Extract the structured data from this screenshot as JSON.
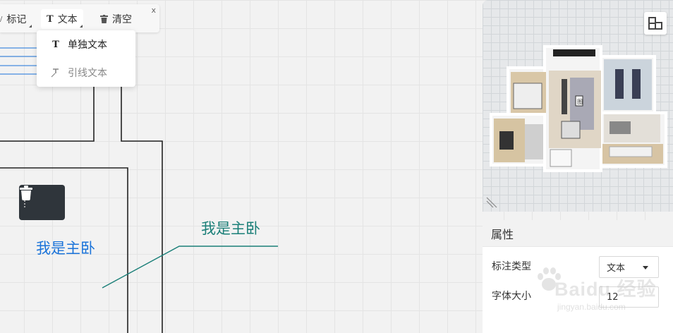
{
  "toolbar": {
    "mark_label": "标记",
    "text_label": "文本",
    "clear_label": "清空",
    "close_label": "x",
    "text_icon": "T"
  },
  "dropdown": {
    "items": [
      {
        "label": "单独文本",
        "icon": "T",
        "state": "active"
      },
      {
        "label": "引线文本",
        "icon": "leader-text-icon",
        "state": "inactive"
      }
    ]
  },
  "canvas": {
    "label_blue": "我是主卧",
    "label_teal": "我是主卧",
    "label_blue_color": "#1a73d9",
    "label_teal_color": "#1a7f78"
  },
  "preview": {
    "icon": "floorplan-toggle-icon",
    "room_label": "图"
  },
  "properties": {
    "title": "属性",
    "annotation_type_label": "标注类型",
    "annotation_type_value": "文本",
    "font_size_label": "字体大小",
    "font_size_value": "12"
  },
  "watermark": {
    "main": "Baidu 经验",
    "sub": "jingyan.baidu.com"
  }
}
